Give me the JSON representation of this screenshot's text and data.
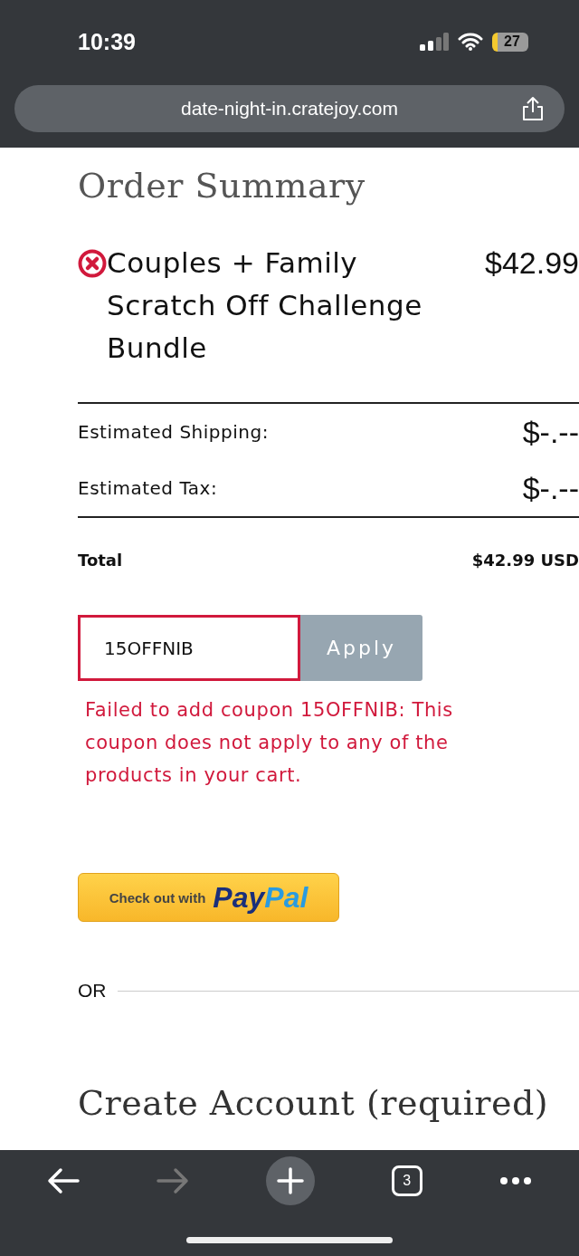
{
  "status_bar": {
    "time": "10:39",
    "battery": "27"
  },
  "address_bar": {
    "url": "date-night-in.cratejoy.com"
  },
  "order_summary": {
    "title": "Order Summary",
    "items": [
      {
        "name": "Couples + Family Scratch Off Challenge Bundle",
        "price": "$42.99"
      }
    ],
    "lines": [
      {
        "label": "Estimated Shipping:",
        "value": "$-.--"
      },
      {
        "label": "Estimated Tax:",
        "value": "$-.--"
      }
    ],
    "total": {
      "label": "Total",
      "value": "$42.99 USD"
    }
  },
  "coupon": {
    "value": "15OFFNIB",
    "button": "Apply",
    "error": "Failed to add coupon 15OFFNIB: This coupon does not apply to any of the products in your cart."
  },
  "paypal": {
    "label": "Check out with",
    "logo": [
      "Pay",
      "Pal"
    ]
  },
  "divider_label": "OR",
  "next_section": "Create Account (required)",
  "toolbar": {
    "tabs": "3",
    "forward_disabled": true
  }
}
